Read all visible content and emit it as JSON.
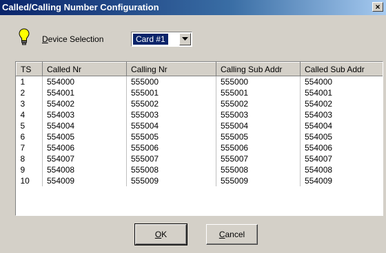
{
  "window": {
    "title": "Called/Calling Number Configuration",
    "close_glyph": "×"
  },
  "device": {
    "label_first": "D",
    "label_rest": "evice Selection",
    "selected": "Card #1",
    "icon": "lightbulb-icon"
  },
  "table": {
    "columns": [
      "TS",
      "Called Nr",
      "Calling Nr",
      "Calling Sub Addr",
      "Called Sub Addr"
    ],
    "rows": [
      [
        "1",
        "554000",
        "555000",
        "555000",
        "554000"
      ],
      [
        "2",
        "554001",
        "555001",
        "555001",
        "554001"
      ],
      [
        "3",
        "554002",
        "555002",
        "555002",
        "554002"
      ],
      [
        "4",
        "554003",
        "555003",
        "555003",
        "554003"
      ],
      [
        "5",
        "554004",
        "555004",
        "555004",
        "554004"
      ],
      [
        "6",
        "554005",
        "555005",
        "555005",
        "554005"
      ],
      [
        "7",
        "554006",
        "555006",
        "555006",
        "554006"
      ],
      [
        "8",
        "554007",
        "555007",
        "555007",
        "554007"
      ],
      [
        "9",
        "554008",
        "555008",
        "555008",
        "554008"
      ],
      [
        "10",
        "554009",
        "555009",
        "555009",
        "554009"
      ]
    ]
  },
  "buttons": {
    "ok_first": "O",
    "ok_rest": "K",
    "cancel_first": "C",
    "cancel_rest": "ancel"
  },
  "colors": {
    "titlebar_start": "#0a246a",
    "dialog_bg": "#d4d0c8",
    "selection": "#0a246a"
  }
}
